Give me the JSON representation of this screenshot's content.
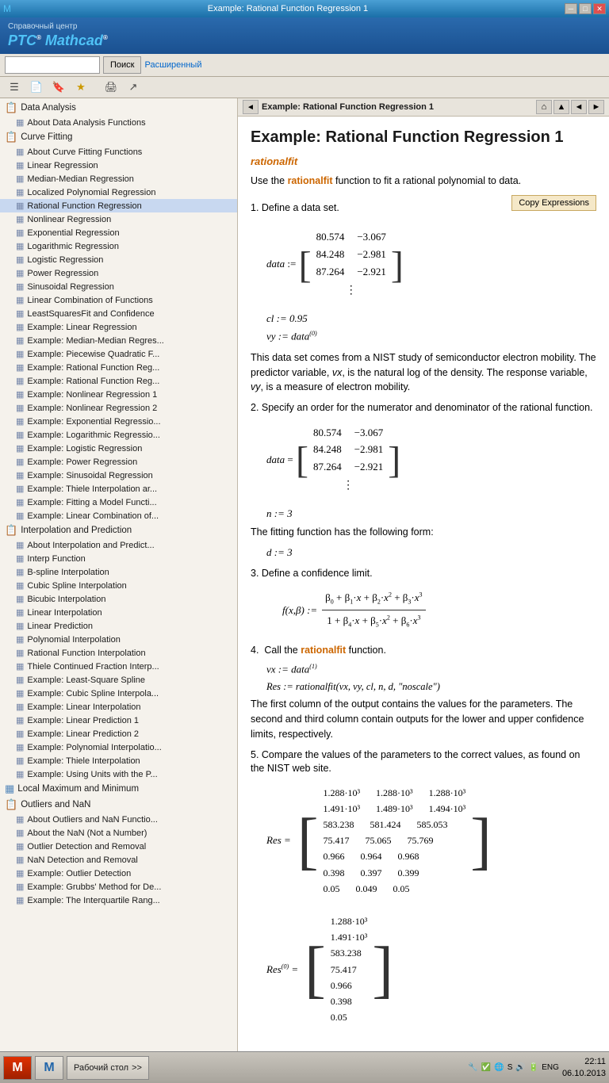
{
  "titlebar": {
    "title": "Example: Rational Function Regression 1",
    "minimize": "─",
    "maximize": "□",
    "close": "✕"
  },
  "appheader": {
    "topline": "Справочный центр",
    "title1": "PTC",
    "title2": "®",
    "title3": " Mathcad",
    "title4": "®"
  },
  "toolbar": {
    "searchPlaceholder": "",
    "searchBtn": "Поиск",
    "advancedLink": "Расширенный"
  },
  "contentnav": {
    "backLabel": "◄",
    "title": "Example: Rational Function Regression 1",
    "homeIcon": "⌂",
    "upIcon": "▲",
    "prevIcon": "◄",
    "nextIcon": "►"
  },
  "content": {
    "title": "Example: Rational Function Regression 1",
    "functionName": "rationalfit",
    "intro": "Use the rationalfit function to fit a rational polynomial to data.",
    "copyBtn": "Copy Expressions",
    "step1": "1.  Define a data set.",
    "matrix1rows": [
      [
        "80.574",
        "−3.067"
      ],
      [
        "84.248",
        "−2.981"
      ],
      [
        "87.264",
        "−2.921"
      ]
    ],
    "assign1": "cl := 0.95",
    "assign2": "vy := data⁽⁰⁾",
    "dataText": "This data set comes from a NIST study of semiconductor electron mobility. The predictor variable, vx, is the natural log of the density. The response variable, vy, is a measure of electron mobility.",
    "step2": "2.  Specify an order for the numerator and denominator of the rational function.",
    "matrix2rows": [
      [
        "80.574",
        "−3.067"
      ],
      [
        "84.248",
        "−2.981"
      ],
      [
        "87.264",
        "−2.921"
      ]
    ],
    "assign3": "n := 3",
    "fittingText": "The fitting function has the following form:",
    "assign4": "d := 3",
    "step3": "3.  Define a confidence limit.",
    "fNumerator": "β₀ + β₁ · x + β₂ · x² + β₃ · x³",
    "fDenominator": "1 + β₄ · x + β₅ · x² + β₆ · x³",
    "fLabel": "f(x,β) :=",
    "step4": "4.  Call the rationalfit function.",
    "assign5": "vx := data⁽¹⁾",
    "resExpr": "Res := rationalfit(vx, vy, cl, n, d, \"noscale\")",
    "step4text": "The first column of the output contains the values for the parameters. The second and third column contain outputs for the lower and upper confidence limits, respectively.",
    "step5": "5.  Compare the values of the parameters to the correct values, as found on the NIST web site.",
    "resMatrix": {
      "label": "Res =",
      "rows": [
        [
          "1.288·10³",
          "1.288·10³",
          "1.288·10³"
        ],
        [
          "1.491·10³",
          "1.489·10³",
          "1.494·10³"
        ],
        [
          "583.238",
          "581.424",
          "585.053"
        ],
        [
          "75.417",
          "75.065",
          "75.769"
        ],
        [
          "0.966",
          "0.964",
          "0.968"
        ],
        [
          "0.398",
          "0.397",
          "0.399"
        ],
        [
          "0.05",
          "0.049",
          "0.05"
        ]
      ]
    },
    "res0Matrix": {
      "label": "Res⁽⁰⁾ =",
      "rows": [
        [
          "1.288·10³"
        ],
        [
          "1.491·10³"
        ],
        [
          "583.238"
        ],
        [
          "75.417"
        ],
        [
          "0.966"
        ],
        [
          "0.398"
        ],
        [
          "0.05"
        ]
      ]
    }
  },
  "sidebar": {
    "sections": [
      {
        "type": "group",
        "icon": "📋",
        "label": "Data Analysis",
        "children": [
          {
            "type": "item",
            "icon": "▦",
            "label": "About Data Analysis Functions"
          }
        ]
      },
      {
        "type": "group",
        "icon": "📋",
        "label": "Curve Fitting",
        "children": [
          {
            "type": "item",
            "icon": "▦",
            "label": "About Curve Fitting Functions"
          },
          {
            "type": "item",
            "icon": "▦",
            "label": "Linear Regression"
          },
          {
            "type": "item",
            "icon": "▦",
            "label": "Median-Median Regression"
          },
          {
            "type": "item",
            "icon": "▦",
            "label": "Localized Polynomial Regression"
          },
          {
            "type": "item",
            "icon": "▦",
            "label": "Rational Function Regression",
            "selected": true
          },
          {
            "type": "item",
            "icon": "▦",
            "label": "Nonlinear Regression"
          },
          {
            "type": "item",
            "icon": "▦",
            "label": "Exponential Regression"
          },
          {
            "type": "item",
            "icon": "▦",
            "label": "Logarithmic Regression"
          },
          {
            "type": "item",
            "icon": "▦",
            "label": "Logistic Regression"
          },
          {
            "type": "item",
            "icon": "▦",
            "label": "Power Regression"
          },
          {
            "type": "item",
            "icon": "▦",
            "label": "Sinusoidal Regression"
          },
          {
            "type": "item",
            "icon": "▦",
            "label": "Linear Combination of Functions"
          },
          {
            "type": "item",
            "icon": "▦",
            "label": "LeastSquaresFit and Confidence"
          },
          {
            "type": "item",
            "icon": "▦",
            "label": "Example: Linear Regression"
          },
          {
            "type": "item",
            "icon": "▦",
            "label": "Example: Median-Median Regres..."
          },
          {
            "type": "item",
            "icon": "▦",
            "label": "Example: Piecewise Quadratic F..."
          },
          {
            "type": "item",
            "icon": "▦",
            "label": "Example: Rational Function Reg..."
          },
          {
            "type": "item",
            "icon": "▦",
            "label": "Example: Rational Function Reg..."
          },
          {
            "type": "item",
            "icon": "▦",
            "label": "Example: Nonlinear Regression 1"
          },
          {
            "type": "item",
            "icon": "▦",
            "label": "Example: Nonlinear Regression 2"
          },
          {
            "type": "item",
            "icon": "▦",
            "label": "Example: Exponential Regressio..."
          },
          {
            "type": "item",
            "icon": "▦",
            "label": "Example: Logarithmic Regressio..."
          },
          {
            "type": "item",
            "icon": "▦",
            "label": "Example: Logistic Regression"
          },
          {
            "type": "item",
            "icon": "▦",
            "label": "Example: Power Regression"
          },
          {
            "type": "item",
            "icon": "▦",
            "label": "Example: Sinusoidal Regression"
          },
          {
            "type": "item",
            "icon": "▦",
            "label": "Example: Thiele Interpolation ar..."
          },
          {
            "type": "item",
            "icon": "▦",
            "label": "Example: Fitting a Model Functi..."
          },
          {
            "type": "item",
            "icon": "▦",
            "label": "Example: Linear Combination of..."
          }
        ]
      },
      {
        "type": "group",
        "icon": "📋",
        "label": "Interpolation and Prediction",
        "children": [
          {
            "type": "item",
            "icon": "▦",
            "label": "About Interpolation and Predict..."
          },
          {
            "type": "item",
            "icon": "▦",
            "label": "Interp Function"
          },
          {
            "type": "item",
            "icon": "▦",
            "label": "B-spline Interpolation"
          },
          {
            "type": "item",
            "icon": "▦",
            "label": "Cubic Spline Interpolation"
          },
          {
            "type": "item",
            "icon": "▦",
            "label": "Bicubic Interpolation"
          },
          {
            "type": "item",
            "icon": "▦",
            "label": "Linear Interpolation"
          },
          {
            "type": "item",
            "icon": "▦",
            "label": "Linear Prediction"
          },
          {
            "type": "item",
            "icon": "▦",
            "label": "Polynomial Interpolation"
          },
          {
            "type": "item",
            "icon": "▦",
            "label": "Rational Function Interpolation"
          },
          {
            "type": "item",
            "icon": "▦",
            "label": "Thiele Continued Fraction Interp..."
          },
          {
            "type": "item",
            "icon": "▦",
            "label": "Example: Least-Square Spline"
          },
          {
            "type": "item",
            "icon": "▦",
            "label": "Example: Cubic Spline Interpola..."
          },
          {
            "type": "item",
            "icon": "▦",
            "label": "Example: Linear Interpolation"
          },
          {
            "type": "item",
            "icon": "▦",
            "label": "Example: Linear Prediction 1"
          },
          {
            "type": "item",
            "icon": "▦",
            "label": "Example: Linear Prediction 2"
          },
          {
            "type": "item",
            "icon": "▦",
            "label": "Example: Polynomial Interpolatio..."
          },
          {
            "type": "item",
            "icon": "▦",
            "label": "Example: Thiele Interpolation"
          },
          {
            "type": "item",
            "icon": "▦",
            "label": "Example: Using Units with the P..."
          }
        ]
      },
      {
        "type": "group",
        "icon": "▦",
        "label": "Local Maximum and Minimum",
        "children": []
      },
      {
        "type": "group",
        "icon": "📋",
        "label": "Outliers and NaN",
        "children": [
          {
            "type": "item",
            "icon": "▦",
            "label": "About Outliers and NaN Functio..."
          },
          {
            "type": "item",
            "icon": "▦",
            "label": "About the NaN (Not a Number)"
          },
          {
            "type": "item",
            "icon": "▦",
            "label": "Outlier Detection and Removal"
          },
          {
            "type": "item",
            "icon": "▦",
            "label": "NaN Detection and Removal"
          },
          {
            "type": "item",
            "icon": "▦",
            "label": "Example: Outlier Detection"
          },
          {
            "type": "item",
            "icon": "▦",
            "label": "Example: Grubbs' Method for De..."
          },
          {
            "type": "item",
            "icon": "▦",
            "label": "Example: The Interquartile Rang..."
          }
        ]
      }
    ]
  },
  "taskbar": {
    "btn1label": "M",
    "btn1color": "#cc4400",
    "btn2label": "M",
    "btn2color": "#2266aa",
    "desktopLabel": "Рабочий стол",
    "expandLabel": ">>",
    "time": "22:11",
    "date": "06.10.2013",
    "lang": "ENG"
  }
}
